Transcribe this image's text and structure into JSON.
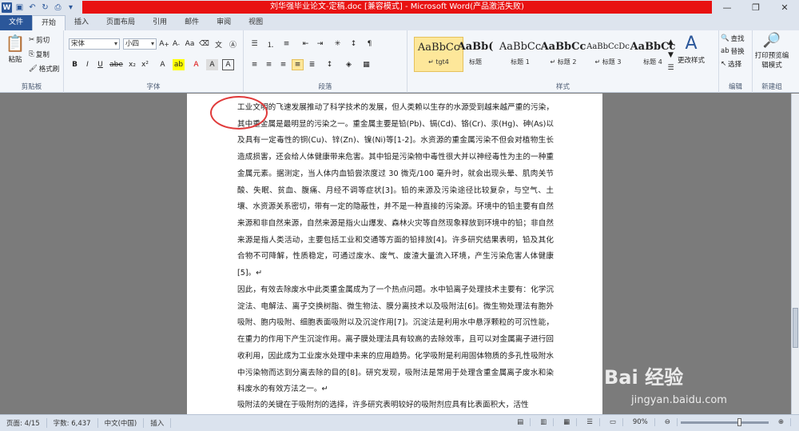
{
  "window": {
    "title": "刘华强毕业论文-定稿.doc [兼容模式] - Microsoft Word(产品激活失败)",
    "controls": [
      "—",
      "❐",
      "✕"
    ]
  },
  "tabs": [
    {
      "label": "文件"
    },
    {
      "label": "开始"
    },
    {
      "label": "插入"
    },
    {
      "label": "页面布局"
    },
    {
      "label": "引用"
    },
    {
      "label": "邮件"
    },
    {
      "label": "审阅"
    },
    {
      "label": "视图"
    }
  ],
  "ribbon": {
    "clipboard": {
      "paste": "粘贴",
      "cut": "剪切",
      "copy": "复制",
      "format_painter": "格式刷",
      "label": "剪贴板"
    },
    "font": {
      "font_name": "宋体",
      "font_size": "小四",
      "label": "字体"
    },
    "paragraph": {
      "label": "段落"
    },
    "styles": {
      "items": [
        {
          "sample": "AaBbCc",
          "name": "↵ tgt4"
        },
        {
          "sample": "AaBb(",
          "name": "标题"
        },
        {
          "sample": "AaBbCc",
          "name": "标题 1"
        },
        {
          "sample": "AaBbCc",
          "name": "↵ 标题 2"
        },
        {
          "sample": "AaBbCcDc",
          "name": "↵ 标题 3"
        },
        {
          "sample": "AaBbCc",
          "name": "标题 4"
        }
      ],
      "change_styles": "更改样式",
      "label": "样式"
    },
    "editing": {
      "find": "查找",
      "replace": "替换",
      "select": "选择",
      "label": "编辑"
    },
    "new_group": {
      "print_preview": "打印预览编辑模式",
      "label": "新建组"
    }
  },
  "document": {
    "paragraphs": [
      "工业文明的飞速发展推动了科学技术的发展，但人类赖以生存的水源受到越来越严重的污染，其中重金属是最明显的污染之一。重金属主要是铅(Pb)、镉(Cd)、铬(Cr)、汞(Hg)、砷(As)以及具有一定毒性的铜(Cu)、锌(Zn)、镍(Ni)等[1-2]。水资源的重金属污染不但会对植物生长造成损害，还会给人体健康带来危害。其中铅是污染物中毒性很大并以神经毒性为主的一种重金属元素。据测定，当人体内血铅尝浓度过 30 微克/100 毫升时，就会出现头晕、肌肉关节酸、失眠、贫血、腹痛、月经不调等症状[3]。铅的来源及污染途径比较复杂，与空气、土壤、水资源关系密切，带有一定的隐蔽性，并不是一种直接的污染源。环境中的铅主要有自然来源和非自然来源，自然来源是指火山爆发、森林火灾等自然现象释放到环境中的铅；非自然来源是指人类活动，主要包括工业和交通等方面的铅排放[4]。许多研究结果表明，铅及其化合物不可降解，性质稳定，可通过废水、废气、废渣大量流入环境，产生污染危害人体健康[5]。↵",
      "因此，有效去除废水中此类重金属成为了一个热点问题。水中铅离子处理技术主要有：化学沉淀法、电解法、离子交换树脂、微生物法、膜分离技术以及吸附法[6]。微生物处理法有胞外吸附、胞内吸附、细胞表面吸附以及沉淀作用[7]。沉淀法是利用水中悬浮颗粒的可沉性能，在重力的作用下产生沉淀作用。离子膜处理法具有较高的去除效率，且可以对金属离子进行回收利用，因此成为工业废水处理中未来的应用趋势。化学吸附是利用固体物质的多孔性吸附水中污染物而达到分离去除的目的[8]。研究发现，吸附法是常用于处理含重金属离子废水和染料废水的有效方法之一。↵",
      "吸附法的关键在于吸附剂的选择，许多研究表明较好的吸附剂应具有比表面积大，活性"
    ]
  },
  "watermark": {
    "brand": "Bai 经验",
    "url": "jingyan.baidu.com"
  },
  "status_bar": {
    "page": "页面: 4/15",
    "words": "字数: 6,437",
    "language": "中文(中国)",
    "mode": "插入",
    "zoom": "90%",
    "zoom_fraction": 0.67
  }
}
